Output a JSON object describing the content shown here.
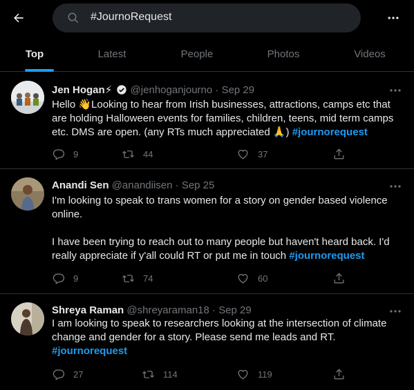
{
  "search": {
    "query": "#JournoRequest"
  },
  "tabs": [
    {
      "label": "Top",
      "active": true
    },
    {
      "label": "Latest",
      "active": false
    },
    {
      "label": "People",
      "active": false
    },
    {
      "label": "Photos",
      "active": false
    },
    {
      "label": "Videos",
      "active": false
    }
  ],
  "colors": {
    "accent": "#1d9bf0",
    "muted": "#71767b",
    "background": "#000000",
    "divider": "#2f3336"
  },
  "tweets": [
    {
      "name": "Jen Hogan",
      "name_emoji": "⚡",
      "verified": true,
      "handle": "@jenhoganjourno",
      "sep": " · ",
      "date": "Sep 29",
      "lines": [
        "Hello 👋Looking to hear from Irish businesses, attractions, camps  etc that",
        "are holding Halloween events for families, children, teens, mid term camps"
      ],
      "last_text": "etc. DMS are open. (any RTs much appreciated 🙏) ",
      "hashtag": "#journorequest",
      "replies": "9",
      "retweets": "44",
      "likes": "37"
    },
    {
      "name": "Anandi Sen",
      "handle": "@anandiisen",
      "sep": " · ",
      "date": "Sep 25",
      "lines": [
        "I'm looking to speak to trans women for a story on gender based violence",
        "online.",
        "",
        "I have been trying to reach out to many people but haven't heard back. I'd"
      ],
      "last_text": "really appreciate if y'all could RT or put me in touch  ",
      "hashtag": "#journorequest",
      "replies": "9",
      "retweets": "74",
      "likes": "60"
    },
    {
      "name": "Shreya Raman",
      "handle": "@shreyaraman18",
      "sep": " · ",
      "date": "Sep 29",
      "lines": [
        "I am looking to speak to researchers looking at the intersection of climate",
        "change and gender for a story. Please send me leads and RT."
      ],
      "last_text": "",
      "hashtag": "#journorequest",
      "replies": "27",
      "retweets": "114",
      "likes": "119"
    }
  ]
}
